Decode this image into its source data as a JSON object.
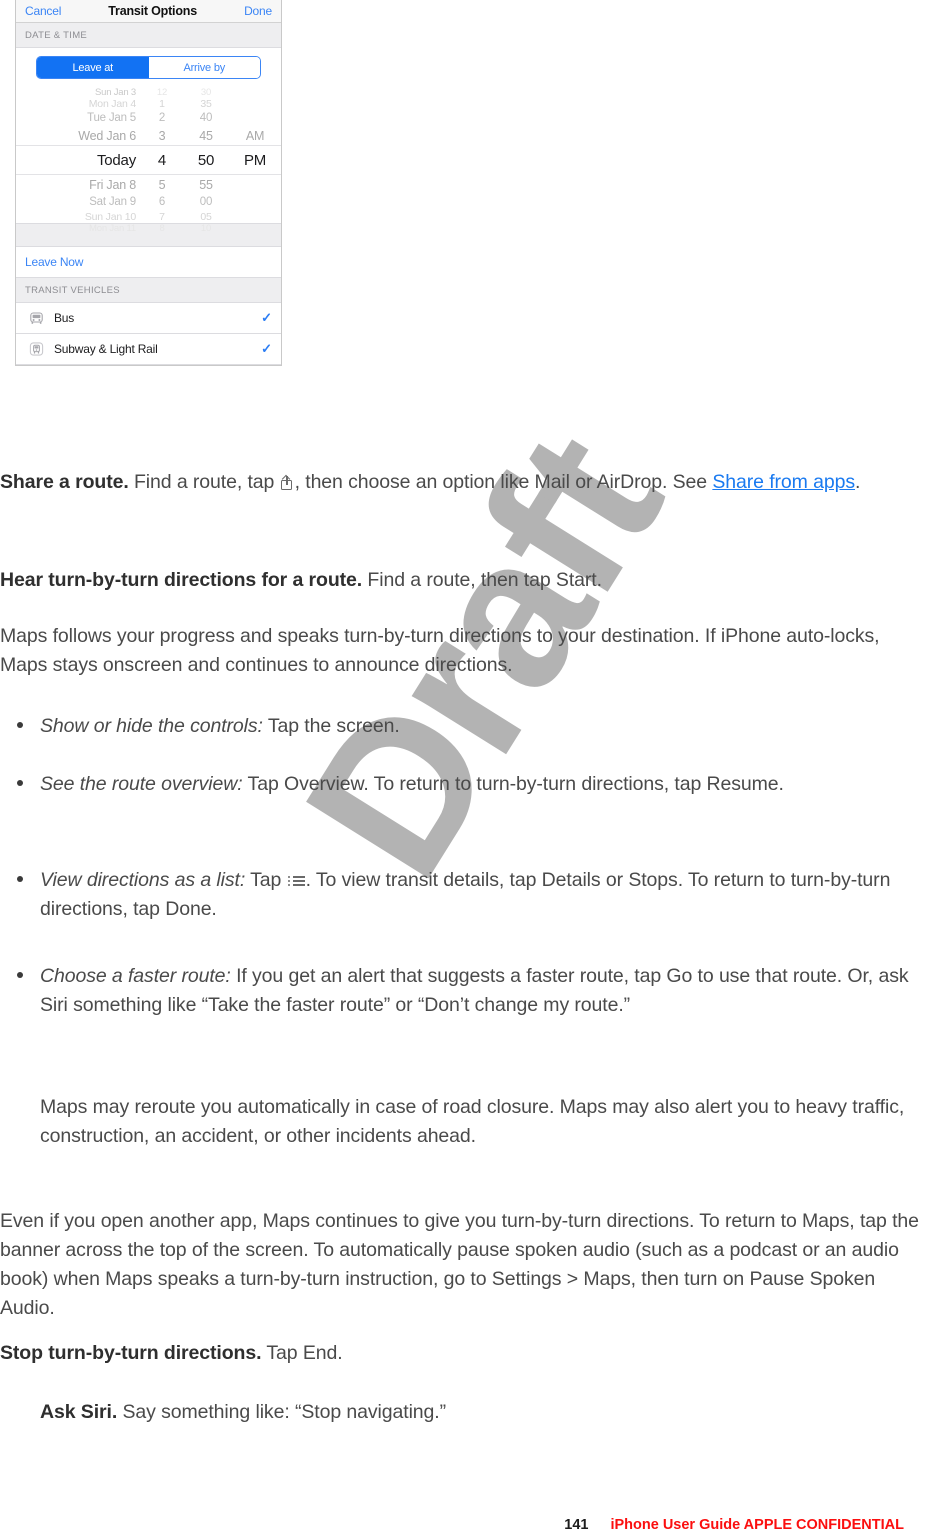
{
  "figure": {
    "name": "transit-options-screenshot",
    "navbar": {
      "cancel": "Cancel",
      "title": "Transit Options",
      "done": "Done"
    },
    "date_time_section": {
      "header": "DATE & TIME",
      "segments": [
        {
          "label": "Leave at",
          "selected": true
        },
        {
          "label": "Arrive by",
          "selected": false
        }
      ],
      "picker": {
        "rows": [
          {
            "day": "Sun Jan 3",
            "hour": "12",
            "minute": "30",
            "ampm": "",
            "fade": "f0"
          },
          {
            "day": "Mon Jan 4",
            "hour": "1",
            "minute": "35",
            "ampm": "",
            "fade": "f1"
          },
          {
            "day": "Tue Jan 5",
            "hour": "2",
            "minute": "40",
            "ampm": "",
            "fade": "f2"
          },
          {
            "day": "Wed Jan 6",
            "hour": "3",
            "minute": "45",
            "ampm": "AM",
            "fade": "f3"
          },
          {
            "day": "Today",
            "hour": "4",
            "minute": "50",
            "ampm": "PM",
            "fade": "sel"
          },
          {
            "day": "Fri Jan 8",
            "hour": "5",
            "minute": "55",
            "ampm": "",
            "fade": "f3"
          },
          {
            "day": "Sat Jan 9",
            "hour": "6",
            "minute": "00",
            "ampm": "",
            "fade": "f2"
          },
          {
            "day": "Sun Jan 10",
            "hour": "7",
            "minute": "05",
            "ampm": "",
            "fade": "f1"
          },
          {
            "day": "Mon Jan 11",
            "hour": "8",
            "minute": "10",
            "ampm": "",
            "fade": "f0"
          }
        ]
      }
    },
    "leave_now": "Leave Now",
    "transit_section": {
      "header": "TRANSIT VEHICLES",
      "rows": [
        {
          "icon": "bus-icon",
          "label": "Bus",
          "checked": "✓"
        },
        {
          "icon": "train-icon",
          "label": "Subway & Light Rail",
          "checked": "✓"
        }
      ]
    }
  },
  "body": {
    "share_route": {
      "lead": "Share a route.",
      "text_before_icon": " Find a route, tap ",
      "text_after_icon": ", then choose an option like Mail or AirDrop. See ",
      "link": "Share from apps",
      "period": "."
    },
    "hear_directions": {
      "lead": "Hear turn-by-turn directions for a route.",
      "text": " Find a route, then tap Start."
    },
    "maps_follows": "Maps follows your progress and speaks turn-by-turn directions to your destination. If iPhone auto-locks, Maps stays onscreen and continues to announce directions.",
    "bullets": [
      {
        "italic": "Show or hide the controls:",
        "text": " Tap the screen."
      },
      {
        "italic": "See the route overview:",
        "text": " Tap Overview. To return to turn-by-turn directions, tap Resume."
      },
      {
        "italic": "View directions as a list:",
        "text_before_icon": " Tap ",
        "text_after_icon": ". To view transit details, tap Details or Stops. To return to turn-by-turn directions, tap Done."
      },
      {
        "italic": "Choose a faster route:",
        "text": " If you get an alert that suggests a faster route, tap Go to use that route. Or, ask Siri something like “Take the faster route” or “Don’t change my route.”"
      }
    ],
    "reroute_note": "Maps may reroute you automatically in case of road closure. Maps may also alert you to heavy traffic, construction, an accident, or other incidents ahead.",
    "another_app": "Even if you open another app, Maps continues to give you turn-by-turn directions. To return to Maps, tap the banner across the top of the screen. To automatically pause spoken audio (such as a podcast or an audio book) when Maps speaks a turn-by-turn instruction, go to Settings > Maps, then turn on Pause Spoken Audio.",
    "stop_directions": {
      "lead": "Stop turn-by-turn directions.",
      "text": " Tap End."
    },
    "ask_siri": {
      "lead": "Ask Siri.",
      "text": " Say something like: “Stop navigating.”"
    }
  },
  "watermark": "Draft",
  "footer": {
    "page_number": "141",
    "confidential": "iPhone User Guide  APPLE CONFIDENTIAL"
  },
  "colors": {
    "ios_blue": "#3b85f5",
    "ios_blue_fill": "#1272f3",
    "link_blue": "#1a7af0",
    "confidential_red": "#fb0f0f",
    "body_text": "#4a4a4a",
    "watermark_gray": "#b3b3b3"
  }
}
